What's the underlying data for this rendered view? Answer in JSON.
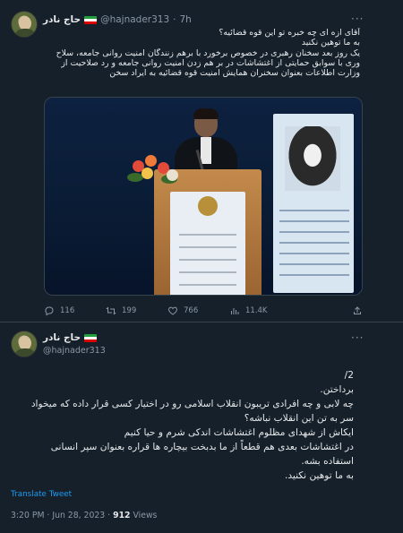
{
  "tweet1": {
    "author_name": "حاج نادر",
    "handle": "@hajnader313",
    "time": "7h",
    "more_label": "···",
    "text_lines": [
      "آقای ازه ای چه خبره تو این قوه قضائیه؟",
      "به ما توهین نکنید",
      "یک روز بعد سخنان رهبری در خصوص برخورد با برهم زنندگان امنیت روانی جامعه، سلاح",
      "وری با سوابق حمایتی از اغتشاشات در بر هم زدن امنیت روانی جامعه و رد صلاحیت از",
      "وزارت اطلاعات بعنوان سخنران همایش امنیت قوه قضائیه به ایراد سخن"
    ],
    "stats": {
      "replies": "116",
      "retweets": "199",
      "likes": "766",
      "views": "11.4K"
    }
  },
  "tweet2": {
    "author_name": "حاج نادر",
    "handle": "@hajnader313",
    "more_label": "···",
    "text_lines": [
      "2/",
      "برداختن.",
      "چه لابی و چه افرادی  تریبون انقلاب اسلامی رو در اختیار کسی قرار داده که میخواد",
      "سر به تن این انقلاب نباشه؟",
      "ایکاش از شهدای مظلوم اغتشاشات اندکی شرم و حیا کنیم",
      "در اغتشاشات بعدی هم قطعاً از ما بدبخت بیچاره ها قراره بعنوان سپر انسانی",
      "استفاده بشه.",
      "به ما توهین نکنید."
    ],
    "translate_label": "Translate Tweet",
    "timestamp": "3:20 PM · Jun 28, 2023 ·",
    "views_count": "912",
    "views_label": "Views"
  },
  "colors": {
    "background": "#15202b",
    "text": "#e7e9ea",
    "secondary": "#8b98a5",
    "link": "#1d9bf0",
    "divider": "#38444d"
  },
  "icons": [
    "reply-icon",
    "retweet-icon",
    "like-icon",
    "views-icon",
    "share-icon",
    "more-icon",
    "iran-flag-icon"
  ]
}
